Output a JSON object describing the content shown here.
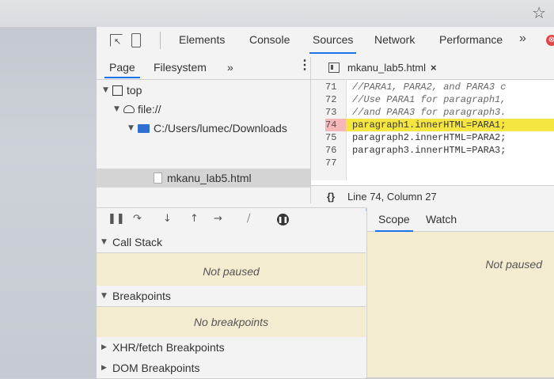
{
  "browser": {
    "star_glyph": "☆"
  },
  "toolbar": {
    "tabs": [
      "Elements",
      "Console",
      "Sources",
      "Network",
      "Performance"
    ],
    "active_tab": "Sources",
    "more_glyph": "»",
    "error_glyph": "⊗"
  },
  "navigator": {
    "tabs": [
      "Page",
      "Filesystem"
    ],
    "more_glyph": "»",
    "menu_glyph": "⋮",
    "tree": [
      {
        "label": "top",
        "icon": "frame-icon"
      },
      {
        "label": "file://",
        "icon": "cloud-icon"
      },
      {
        "label": "C:/Users/lumec/Downloads",
        "icon": "folder-icon"
      },
      {
        "label": "mkanu_lab5.html",
        "icon": "file-icon"
      }
    ]
  },
  "editor": {
    "file_tab": "mkanu_lab5.html",
    "close_glyph": "×",
    "line_numbers": [
      "71",
      "72",
      "73",
      "74",
      "75",
      "76",
      "77"
    ],
    "highlighted_line": "74",
    "lines": [
      "//PARA1, PARA2, and PARA3 c",
      "//Use PARA1 for paragraph1,",
      "//and PARA3 for paragraph3.",
      "paragraph1.innerHTML=PARA1;",
      "paragraph2.innerHTML=PARA2;",
      "paragraph3.innerHTML=PARA3;",
      ""
    ],
    "status_braces": "{}",
    "status": "Line 74, Column 27"
  },
  "debugger": {
    "call_stack": {
      "label": "Call Stack",
      "message": "Not paused"
    },
    "breakpoints": {
      "label": "Breakpoints",
      "message": "No breakpoints"
    },
    "xhr": {
      "label": "XHR/fetch Breakpoints"
    },
    "dom": {
      "label": "DOM Breakpoints"
    }
  },
  "right_panel": {
    "tabs": [
      "Scope",
      "Watch"
    ],
    "message": "Not paused"
  }
}
